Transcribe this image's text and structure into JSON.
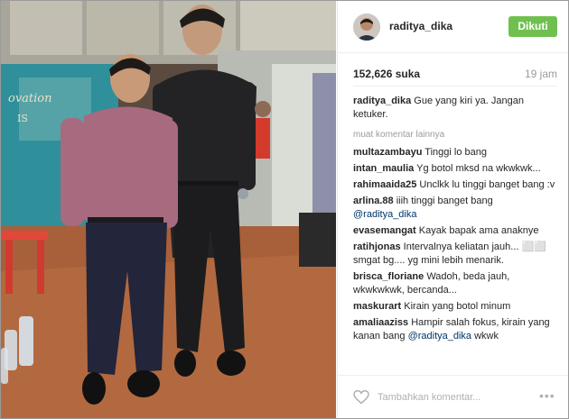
{
  "post": {
    "username": "raditya_dika",
    "follow_label": "Dikuti",
    "likes": "152,626 suka",
    "time": "19 jam",
    "caption_user": "raditya_dika",
    "caption_text": "Gue yang kiri ya. Jangan ketuker.",
    "more_comments": "muat komentar lainnya",
    "add_comment_placeholder": "Tambahkan komentar...",
    "options_label": "•••"
  },
  "comments": [
    {
      "user": "multazambayu",
      "text": "Tinggi lo bang"
    },
    {
      "user": "intan_maulia",
      "text": "Yg botol mksd na wkwkwk..."
    },
    {
      "user": "rahimaaida25",
      "text": "Unclkk lu tinggi banget bang :v"
    },
    {
      "user": "arlina.88",
      "text": "iiih tinggi banget bang",
      "mention": "@raditya_dika"
    },
    {
      "user": "evasemangat",
      "text": "Kayak bapak ama anaknye"
    },
    {
      "user": "ratihjonas",
      "text": "Intervalnya keliatan jauh... ⬜⬜ smgat bg.... yg mini lebih menarik."
    },
    {
      "user": "brisca_floriane",
      "text": "Wadoh, beda jauh, wkwkwkwk, bercanda..."
    },
    {
      "user": "maskurart",
      "text": "Kirain yang botol minum"
    },
    {
      "user": "amaliaaziss",
      "text": "Hampir salah fokus, kirain yang kanan bang",
      "mention": "@raditya_dika",
      "after": "wkwk"
    }
  ],
  "colors": {
    "follow_bg": "#70c050",
    "mention": "#003569",
    "muted": "#9b9b9b"
  }
}
